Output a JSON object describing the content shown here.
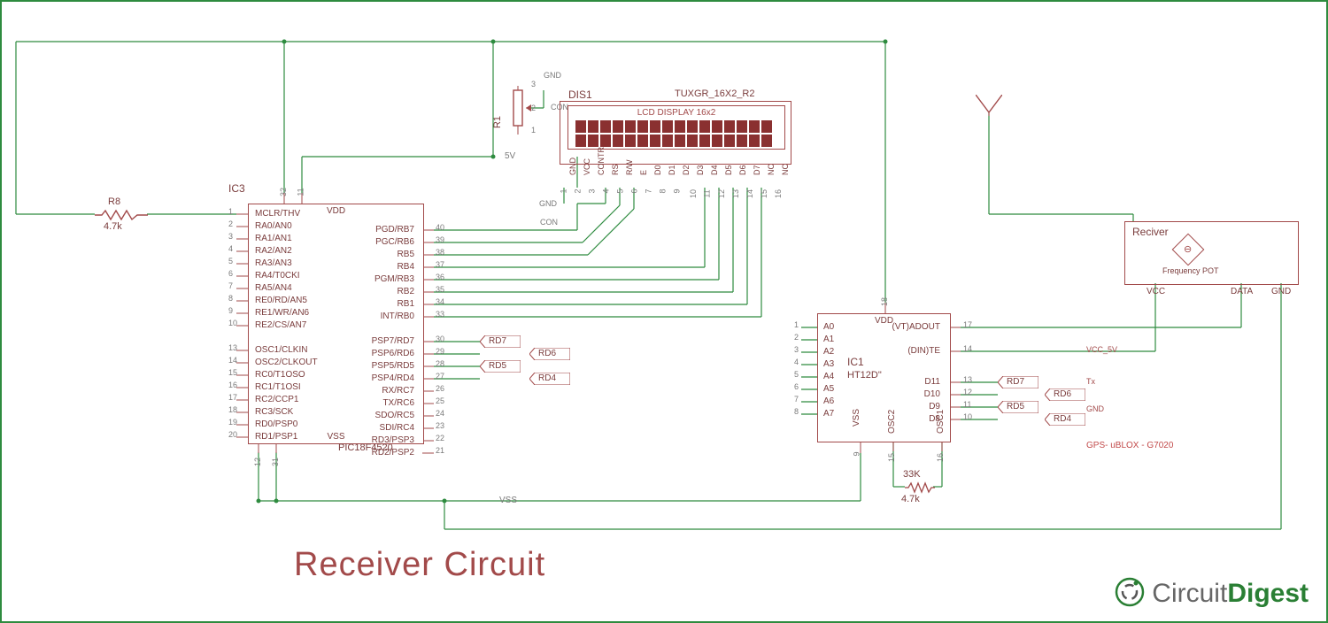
{
  "title": "Receiver Circuit",
  "logo": {
    "part1": "Circuit",
    "part2": "Digest"
  },
  "ic3": {
    "ref": "IC3",
    "part": "PIC18F4520",
    "vdd": "VDD",
    "vss": "VSS",
    "left_pins": [
      {
        "n": "1",
        "name": "MCLR/THV"
      },
      {
        "n": "2",
        "name": "RA0/AN0"
      },
      {
        "n": "3",
        "name": "RA1/AN1"
      },
      {
        "n": "4",
        "name": "RA2/AN2"
      },
      {
        "n": "5",
        "name": "RA3/AN3"
      },
      {
        "n": "6",
        "name": "RA4/T0CKI"
      },
      {
        "n": "7",
        "name": "RA5/AN4"
      },
      {
        "n": "8",
        "name": "RE0/RD/AN5"
      },
      {
        "n": "9",
        "name": "RE1/WR/AN6"
      },
      {
        "n": "10",
        "name": "RE2/CS/AN7"
      },
      {
        "n": "13",
        "name": "OSC1/CLKIN"
      },
      {
        "n": "14",
        "name": "OSC2/CLKOUT"
      },
      {
        "n": "15",
        "name": "RC0/T1OSO"
      },
      {
        "n": "16",
        "name": "RC1/T1OSI"
      },
      {
        "n": "17",
        "name": "RC2/CCP1"
      },
      {
        "n": "18",
        "name": "RC3/SCK"
      },
      {
        "n": "19",
        "name": "RD0/PSP0"
      },
      {
        "n": "20",
        "name": "RD1/PSP1"
      }
    ],
    "right_pins": [
      {
        "n": "40",
        "name": "PGD/RB7"
      },
      {
        "n": "39",
        "name": "PGC/RB6"
      },
      {
        "n": "38",
        "name": "RB5"
      },
      {
        "n": "37",
        "name": "RB4"
      },
      {
        "n": "36",
        "name": "PGM/RB3"
      },
      {
        "n": "35",
        "name": "RB2"
      },
      {
        "n": "34",
        "name": "RB1"
      },
      {
        "n": "33",
        "name": "INT/RB0"
      },
      {
        "n": "30",
        "name": "PSP7/RD7"
      },
      {
        "n": "29",
        "name": "PSP6/RD6"
      },
      {
        "n": "28",
        "name": "PSP5/RD5"
      },
      {
        "n": "27",
        "name": "PSP4/RD4"
      },
      {
        "n": "26",
        "name": "RX/RC7"
      },
      {
        "n": "25",
        "name": "TX/RC6"
      },
      {
        "n": "24",
        "name": "SDO/RC5"
      },
      {
        "n": "23",
        "name": "SDI/RC4"
      },
      {
        "n": "22",
        "name": "RD3/PSP3"
      },
      {
        "n": "21",
        "name": "RD2/PSP2"
      }
    ],
    "top_pins": {
      "n11": "11",
      "n32": "32"
    },
    "bot_pins": {
      "n12": "12",
      "n31": "31"
    }
  },
  "ic1": {
    "ref": "IC1",
    "part": "HT12D\"",
    "vdd": "VDD",
    "vss": "VSS",
    "left_pins": [
      {
        "n": "1",
        "name": "A0"
      },
      {
        "n": "2",
        "name": "A1"
      },
      {
        "n": "3",
        "name": "A2"
      },
      {
        "n": "4",
        "name": "A3"
      },
      {
        "n": "5",
        "name": "A4"
      },
      {
        "n": "6",
        "name": "A5"
      },
      {
        "n": "7",
        "name": "A6"
      },
      {
        "n": "8",
        "name": "A7"
      }
    ],
    "right_pins": [
      {
        "n": "17",
        "name": "(VT)ADOUT"
      },
      {
        "n": "14",
        "name": "(DIN)TE"
      },
      {
        "n": "13",
        "name": "D11"
      },
      {
        "n": "12",
        "name": "D10"
      },
      {
        "n": "11",
        "name": "D9"
      },
      {
        "n": "10",
        "name": "D8"
      }
    ],
    "bot_pins": [
      {
        "n": "9",
        "name": "VSS"
      },
      {
        "n": "15",
        "name": "OSC2"
      },
      {
        "n": "16",
        "name": "OSC1"
      }
    ],
    "top_pin": {
      "n": "18"
    }
  },
  "lcd": {
    "ref": "DIS1",
    "part": "TUXGR_16X2_R2",
    "panel_text": "LCD DISPLAY 16x2",
    "pins": [
      "GND",
      "VCC",
      "CONTR",
      "RS",
      "R/W",
      "E",
      "D0",
      "D1",
      "D2",
      "D3",
      "D4",
      "D5",
      "D6",
      "D7",
      "NC",
      "NC"
    ],
    "pinnums": [
      "1",
      "2",
      "3",
      "4",
      "5",
      "6",
      "7",
      "8",
      "9",
      "10",
      "11",
      "12",
      "13",
      "14",
      "15",
      "16"
    ]
  },
  "r8": {
    "ref": "R8",
    "value": "4.7k"
  },
  "r1": {
    "ref": "R1"
  },
  "r_osc": {
    "ref": "33K",
    "value": "4.7k"
  },
  "nets": {
    "gnd": "GND",
    "v5": "5V",
    "vss": "VSS",
    "con": "CON",
    "vcc5v": "VCC_5V",
    "tx": "Tx",
    "receiver_gnd": "GND"
  },
  "hier_labels": {
    "rd7": "RD7",
    "rd6": "RD6",
    "rd5": "RD5",
    "rd4": "RD4"
  },
  "receiver": {
    "title": "Reciver",
    "freq": "Frequency POT",
    "vcc": "VCC",
    "data": "DATA",
    "gnd": "GND"
  },
  "gps": "GPS- uBLOX - G7020"
}
